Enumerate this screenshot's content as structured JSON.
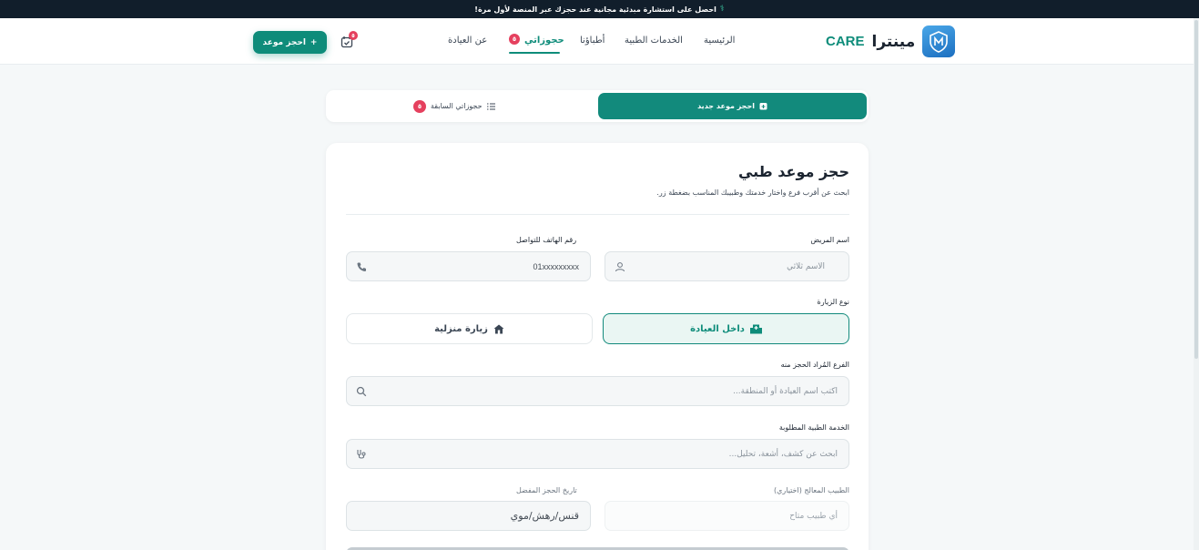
{
  "promo": {
    "text": "احصل على استشارة مبدئية مجانية عند حجزك عبر المنصة لأول مرة!"
  },
  "brand": {
    "name": "مينترا",
    "suffix": "CARE",
    "logo_text": "MINTRA CARE"
  },
  "nav": {
    "items": [
      {
        "label": "الرئيسية"
      },
      {
        "label": "الخدمات الطبية"
      },
      {
        "label": "أطباؤنا"
      },
      {
        "label": "حجوزاتي"
      },
      {
        "label": "عن العيادة"
      }
    ],
    "bookings_badge": "٥",
    "cart_badge": "٥",
    "book_button": "احجز موعد"
  },
  "tabs": {
    "new_label": "احجز موعد جديد",
    "previous_label": "حجوزاتي السابقة",
    "previous_badge": "٥"
  },
  "form": {
    "title": "حجز موعد طبي",
    "subtitle": "ابحث عن أقرب فرع واختار خدمتك وطبيبك المناسب بضغطة زر.",
    "patient_name_label": "اسم المريض",
    "patient_name_placeholder": "الاسم ثلاثي",
    "phone_label": "رقم الهاتف للتواصل",
    "phone_placeholder": "01xxxxxxxxx",
    "visit_type_label": "نوع الزيارة",
    "visit_in_clinic": "داخل العيادة",
    "visit_home": "زيارة منزلية",
    "branch_label": "الفرع المُراد الحجز منه",
    "branch_placeholder": "اكتب اسم العيادة أو المنطقة...",
    "service_label": "الخدمة الطبية المطلوبة",
    "service_placeholder": "ابحث عن كشف، أشعة، تحليل...",
    "doctor_label": "الطبيب المعالج (اختياري)",
    "doctor_placeholder": "أي طبيب متاح",
    "date_label": "تاريخ الحجز المفضل",
    "date_placeholder": "قنس/رهش/موي"
  },
  "colors": {
    "accent": "#0e8c7a",
    "badge": "#e5405e",
    "promo_bg": "#111e2b"
  }
}
